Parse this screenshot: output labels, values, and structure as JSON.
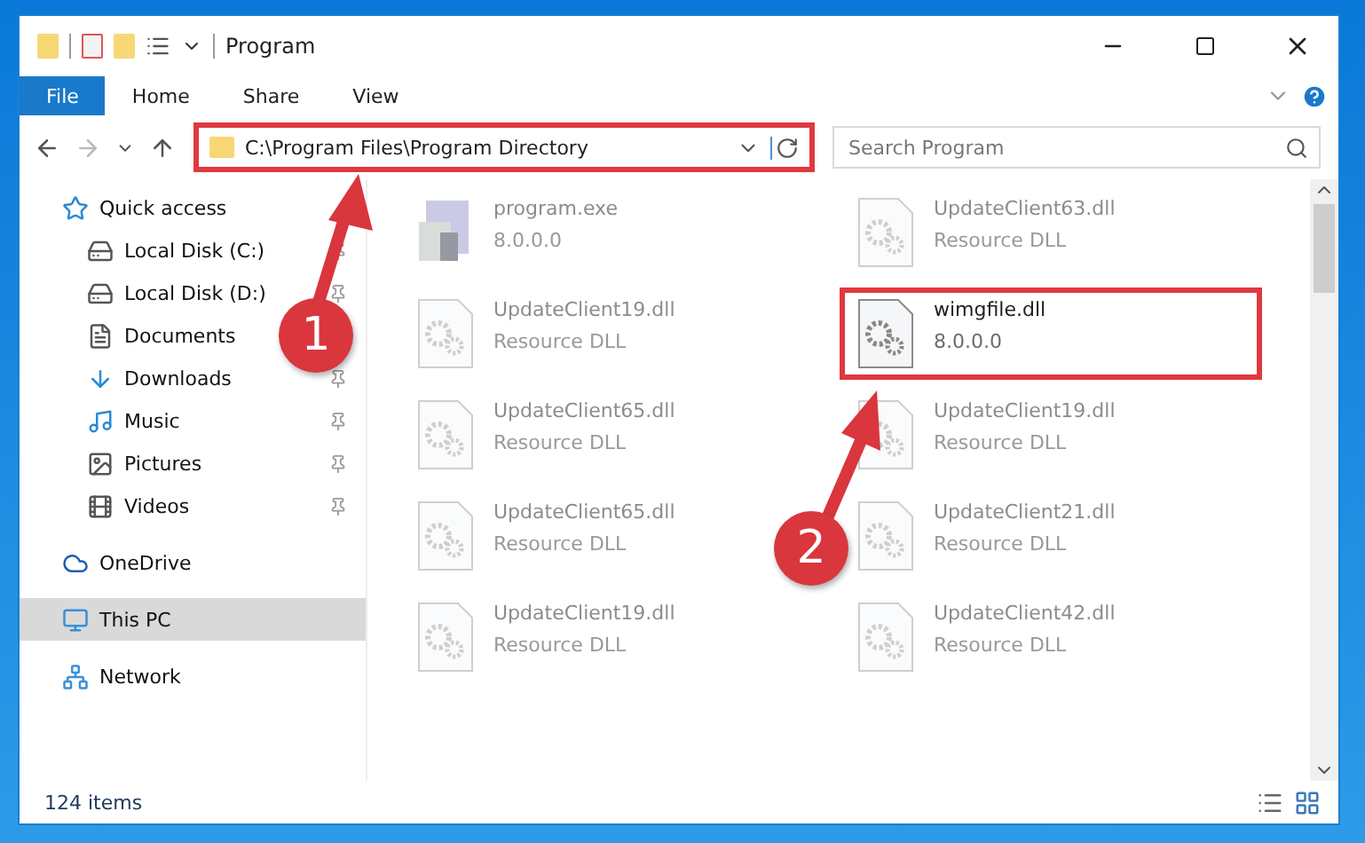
{
  "window": {
    "title": "Program"
  },
  "ribbon_tabs": [
    {
      "label": "File",
      "selected": true
    },
    {
      "label": "Home",
      "selected": false
    },
    {
      "label": "Share",
      "selected": false
    },
    {
      "label": "View",
      "selected": false
    }
  ],
  "address_bar": {
    "path": "C:\\Program Files\\Program Directory",
    "highlight": true
  },
  "search": {
    "placeholder": "Search Program"
  },
  "sidebar": {
    "items": [
      {
        "label": "Quick access",
        "kind": "star",
        "selected": false,
        "children": [
          {
            "label": "Local Disk (C:)",
            "kind": "drive-c",
            "pinned": true,
            "selected": false
          },
          {
            "label": "Local Disk (D:)",
            "kind": "drive",
            "pinned": true,
            "selected": false
          },
          {
            "label": "Documents",
            "kind": "documents",
            "selected": false
          },
          {
            "label": "Downloads",
            "kind": "downloads",
            "pinned": true,
            "selected": false
          },
          {
            "label": "Music",
            "kind": "music",
            "pinned": true,
            "selected": false
          },
          {
            "label": "Pictures",
            "kind": "pictures",
            "pinned": true,
            "selected": false
          },
          {
            "label": "Videos",
            "kind": "videos",
            "pinned": true,
            "selected": false
          }
        ]
      },
      {
        "label": "OneDrive",
        "kind": "cloud",
        "selected": false
      },
      {
        "label": "This PC",
        "kind": "pc",
        "selected": true
      },
      {
        "label": "Network",
        "kind": "network",
        "selected": false
      }
    ]
  },
  "files": [
    {
      "name": "program.exe",
      "detail": "8.0.0.0",
      "kind": "exe",
      "highlight": false
    },
    {
      "name": "UpdateClient63.dll",
      "detail": "Resource DLL",
      "kind": "dll",
      "highlight": false
    },
    {
      "name": "UpdateClient19.dll",
      "detail": "Resource DLL",
      "kind": "dll",
      "highlight": false
    },
    {
      "name": "wimgfile.dll",
      "detail": "8.0.0.0",
      "kind": "dll",
      "highlight": true
    },
    {
      "name": "UpdateClient65.dll",
      "detail": "Resource DLL",
      "kind": "dll",
      "highlight": false
    },
    {
      "name": "UpdateClient19.dll",
      "detail": "Resource DLL",
      "kind": "dll",
      "highlight": false
    },
    {
      "name": "UpdateClient65.dll",
      "detail": "Resource DLL",
      "kind": "dll",
      "highlight": false
    },
    {
      "name": "UpdateClient21.dll",
      "detail": "Resource DLL",
      "kind": "dll",
      "highlight": false
    },
    {
      "name": "UpdateClient19.dll",
      "detail": "Resource DLL",
      "kind": "dll",
      "highlight": false
    },
    {
      "name": "UpdateClient42.dll",
      "detail": "Resource DLL",
      "kind": "dll",
      "highlight": false
    }
  ],
  "annotations": [
    {
      "number": "1"
    },
    {
      "number": "2"
    }
  ],
  "status_bar": {
    "item_count": "124 items"
  }
}
